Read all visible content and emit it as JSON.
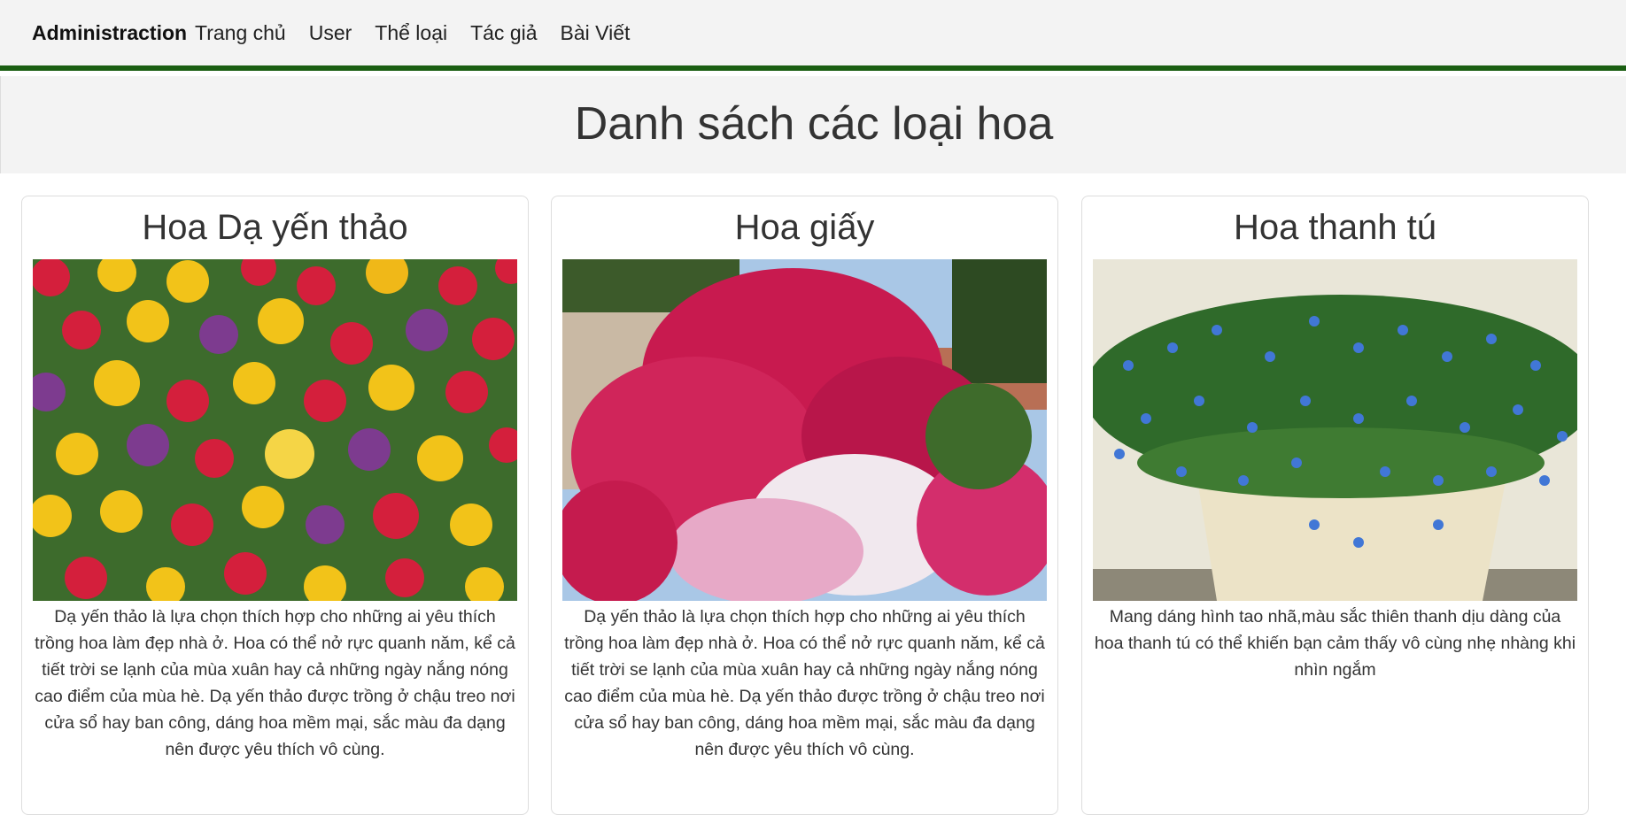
{
  "navbar": {
    "brand": "Administraction",
    "links": [
      "Trang chủ",
      "User",
      "Thể loại",
      "Tác giả",
      "Bài Viết"
    ]
  },
  "page": {
    "title": "Danh sách các loại hoa"
  },
  "cards": [
    {
      "title": "Hoa Dạ yến thảo",
      "image": "petunia-flower-photo",
      "description": "Dạ yến thảo là lựa chọn thích hợp cho những ai yêu thích trồng hoa làm đẹp nhà ở. Hoa có thể nở rực quanh năm, kể cả tiết trời se lạnh của mùa xuân hay cả những ngày nắng nóng cao điểm của mùa hè. Dạ yến thảo được trồng ở chậu treo nơi cửa sổ hay ban công, dáng hoa mềm mại, sắc màu đa dạng nên được yêu thích vô cùng."
    },
    {
      "title": "Hoa giấy",
      "image": "bougainvillea-flower-photo",
      "description": "Dạ yến thảo là lựa chọn thích hợp cho những ai yêu thích trồng hoa làm đẹp nhà ở. Hoa có thể nở rực quanh năm, kể cả tiết trời se lạnh của mùa xuân hay cả những ngày nắng nóng cao điểm của mùa hè. Dạ yến thảo được trồng ở chậu treo nơi cửa sổ hay ban công, dáng hoa mềm mại, sắc màu đa dạng nên được yêu thích vô cùng."
    },
    {
      "title": "Hoa thanh tú",
      "image": "blue-daze-flower-photo",
      "description": "Mang dáng hình tao nhã,màu sắc thiên thanh dịu dàng của hoa thanh tú có thể khiến bạn cảm thấy vô cùng nhẹ nhàng khi nhìn ngắm"
    }
  ],
  "colors": {
    "nav_border": "#1a5e12",
    "header_bg": "#f3f3f3"
  }
}
